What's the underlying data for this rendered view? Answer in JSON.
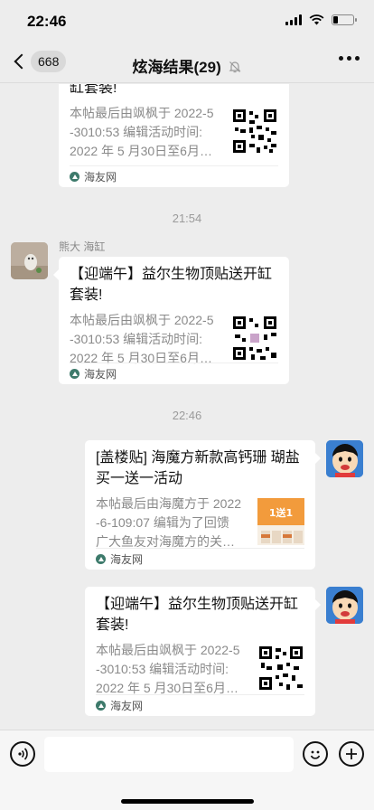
{
  "status": {
    "time": "22:46",
    "battery_level": 0.25
  },
  "nav": {
    "unread_count": "668",
    "title": "炫海结果(29)"
  },
  "source_name": "海友网",
  "messages": [
    {
      "title": "缸套装!",
      "desc": "本帖最后由飒枫于 2022-5\n-3010:53 编辑活动时间:\n2022 年 5 月30日至6月…",
      "source": "海友网",
      "thumb": "qr-code"
    },
    {
      "time": "21:54",
      "sender": "熊大 海缸",
      "title": "【迎端午】益尔生物顶贴送开缸套装!",
      "desc": "本帖最后由飒枫于 2022-5\n-3010:53 编辑活动时间:\n2022 年 5 月30日至6月…",
      "source": "海友网",
      "thumb": "qr-code"
    },
    {
      "time": "22:46",
      "title": "[盖楼贴] 海魔方新款高钙珊 瑚盐买一送一活动",
      "desc": "本帖最后由海魔方于 2022\n-6-109:07 编辑为了回馈\n广大鱼友对海魔方的关…",
      "source": "海友网",
      "thumb": "promo-image",
      "thumb_text": "1送1"
    },
    {
      "title": "【迎端午】益尔生物顶贴送开缸套装!",
      "desc": "本帖最后由飒枫于 2022-5\n-3010:53 编辑活动时间:\n2022 年 5 月30日至6月…",
      "source": "海友网",
      "thumb": "qr-code"
    }
  ],
  "input": {
    "placeholder": ""
  },
  "icons": {
    "voice": "voice-icon",
    "emoji": "emoji-icon",
    "plus": "plus-icon",
    "more": "more-icon",
    "back": "back-icon",
    "mute": "mute-icon"
  }
}
